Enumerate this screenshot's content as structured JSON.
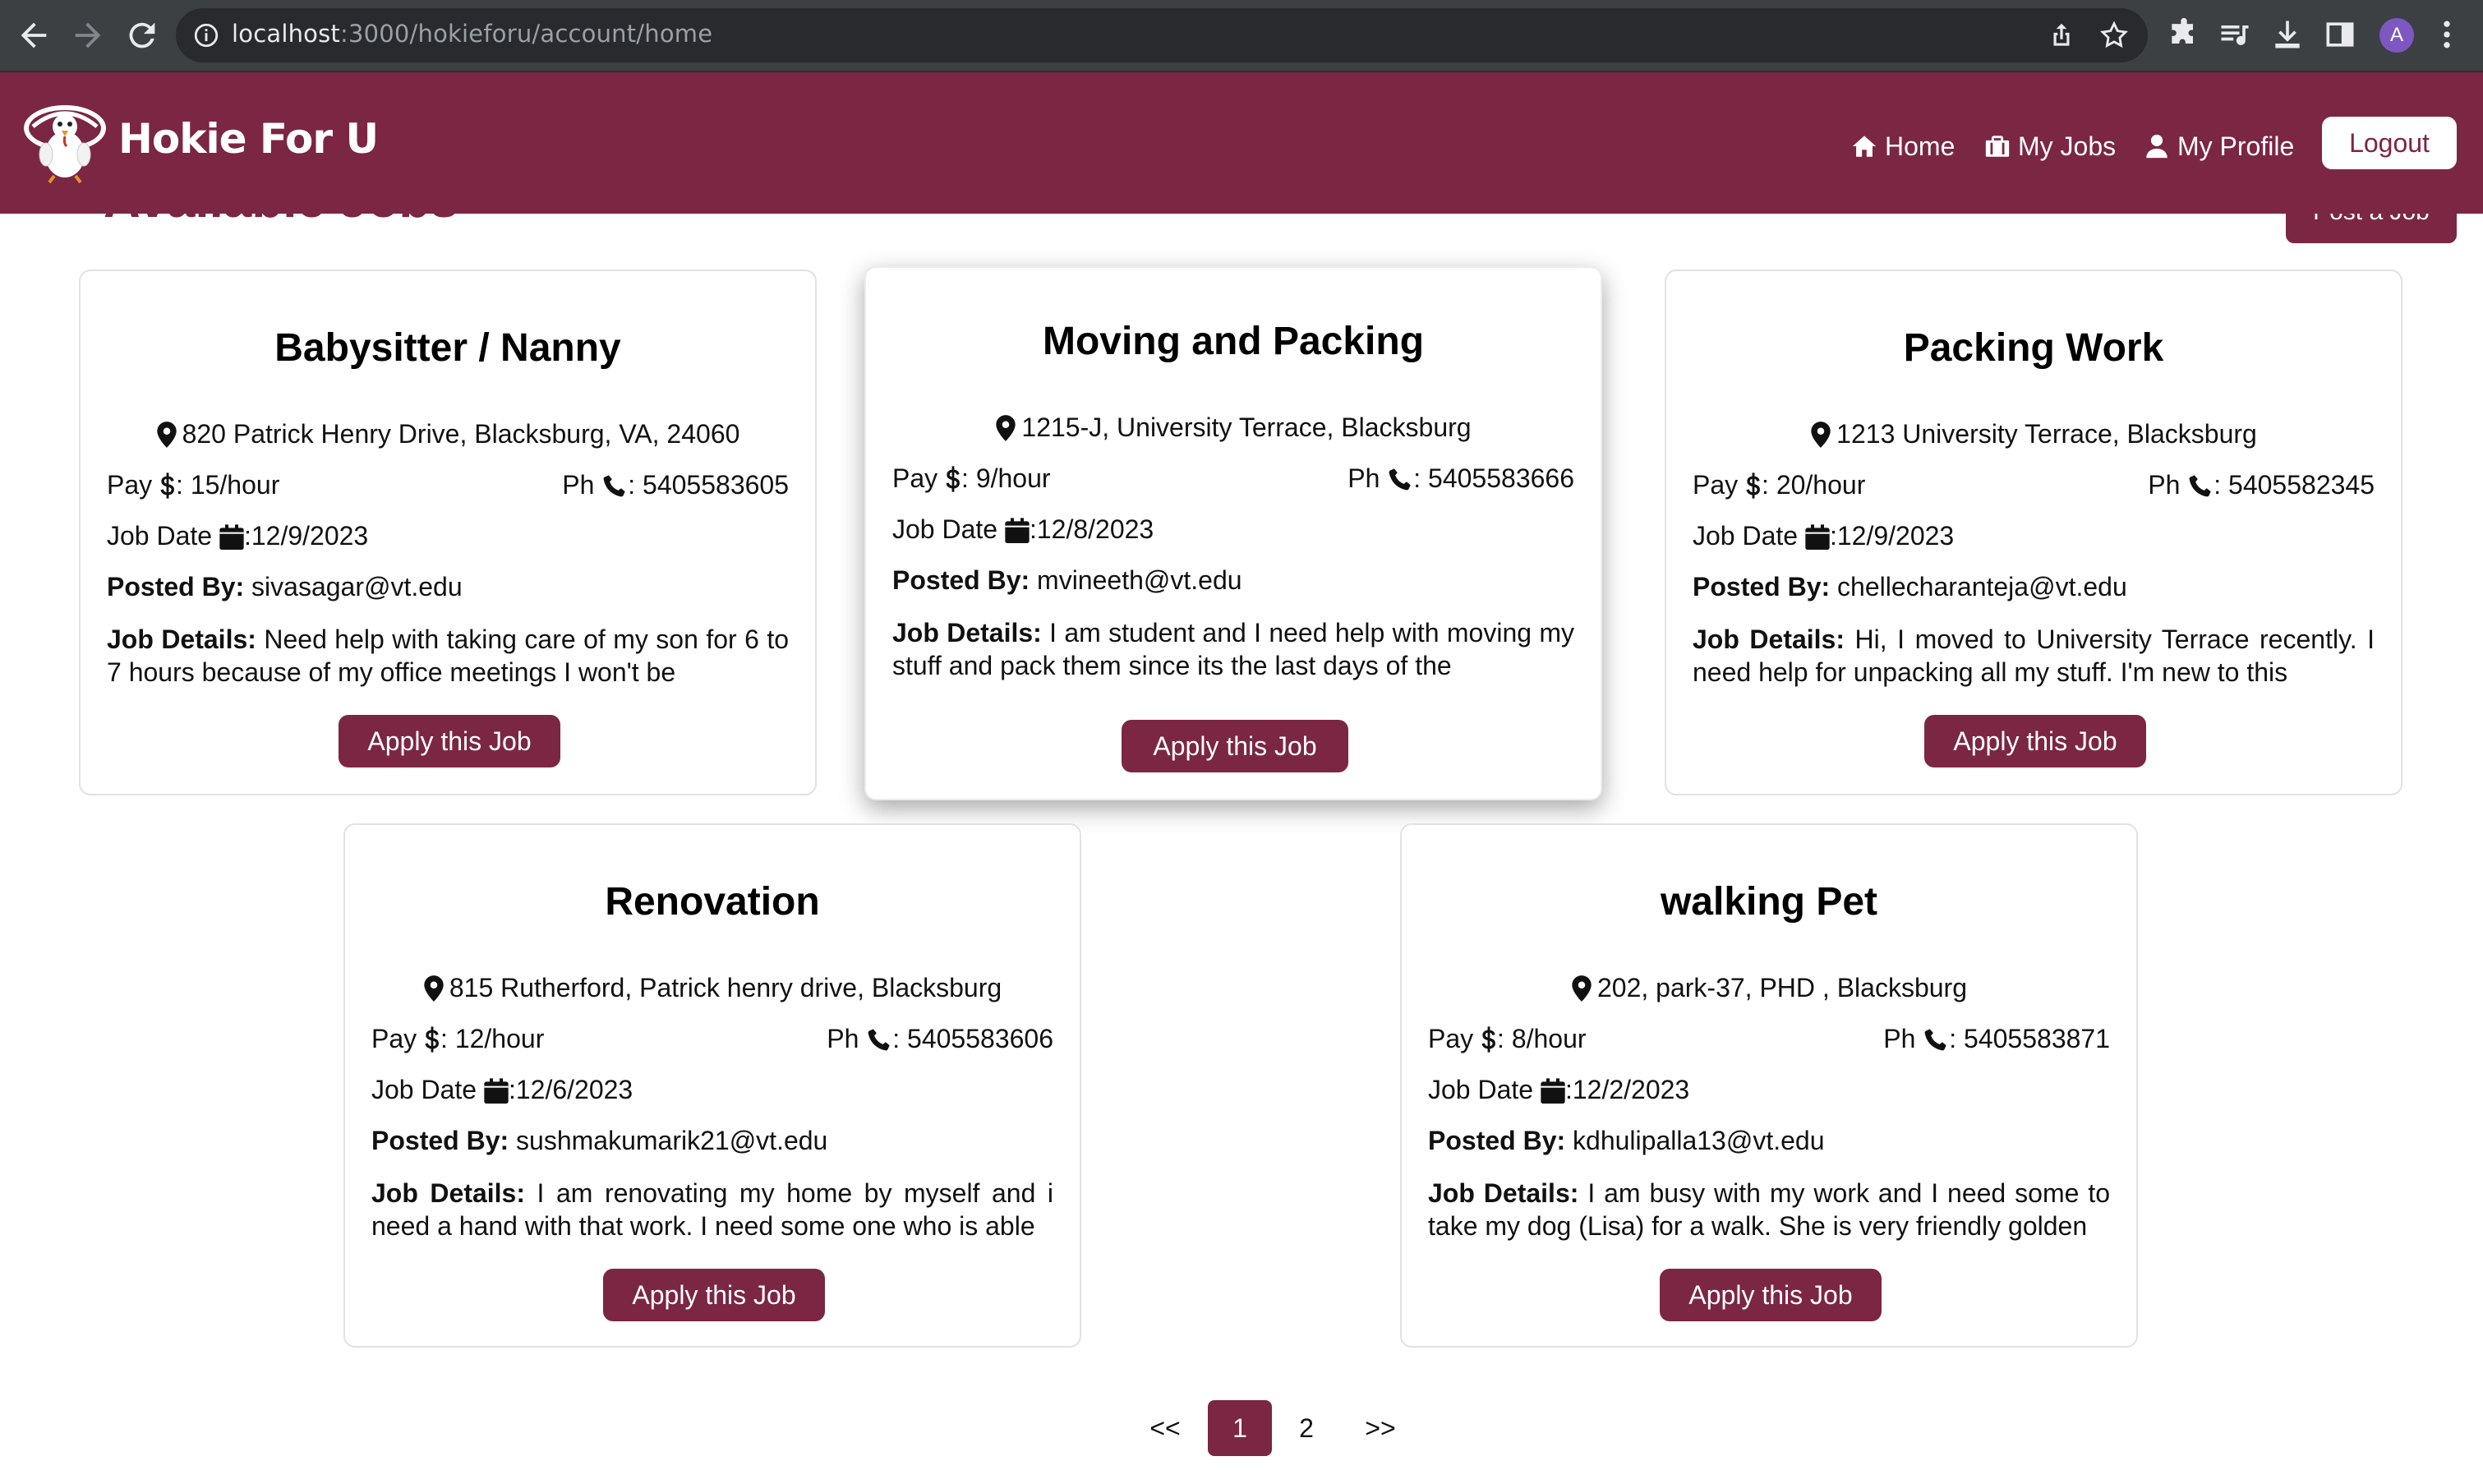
{
  "browser": {
    "url_host": "localhost",
    "url_path": ":3000/hokieforu/account/home",
    "profile_initial": "A"
  },
  "header": {
    "brand": "Hokie For U",
    "nav": {
      "home": "Home",
      "my_jobs": "My Jobs",
      "my_profile": "My Profile"
    },
    "logout": "Logout"
  },
  "main": {
    "section_title": "Available Jobs",
    "post_job": "Post a Job"
  },
  "labels": {
    "pay": "Pay",
    "pay_suffix": ": ",
    "phone": "Ph",
    "phone_suffix": ": ",
    "job_date": "Job Date",
    "posted_by": "Posted By:",
    "job_details": "Job Details:",
    "apply": "Apply this Job"
  },
  "jobs": [
    {
      "title": "Babysitter / Nanny",
      "location": "820 Patrick Henry Drive, Blacksburg, VA, 24060",
      "pay": "15/hour",
      "phone": "5405583605",
      "date": ":12/9/2023",
      "posted_by": "sivasagar@vt.edu",
      "details": "Need help with taking care of my son for 6 to 7 hours because of my office meetings I won't be"
    },
    {
      "title": "Moving and Packing",
      "location": "1215-J, University Terrace, Blacksburg",
      "pay": "9/hour",
      "phone": "5405583666",
      "date": ":12/8/2023",
      "posted_by": "mvineeth@vt.edu",
      "details": "I am student and I need help with moving my stuff and pack them since its the last days of the"
    },
    {
      "title": "Packing Work",
      "location": "1213 University Terrace, Blacksburg",
      "pay": "20/hour",
      "phone": "5405582345",
      "date": ":12/9/2023",
      "posted_by": "chellecharanteja@vt.edu",
      "details": "Hi, I moved to University Terrace recently. I need help for unpacking all my stuff. I'm new to this"
    },
    {
      "title": "Renovation",
      "location": "815 Rutherford, Patrick henry drive, Blacksburg",
      "pay": "12/hour",
      "phone": "5405583606",
      "date": ":12/6/2023",
      "posted_by": "sushmakumarik21@vt.edu",
      "details": "I am renovating my home by myself and i need a hand with that work. I need some one who is able"
    },
    {
      "title": "walking Pet",
      "location": "202, park-37, PHD , Blacksburg",
      "pay": "8/hour",
      "phone": "5405583871",
      "date": ":12/2/2023",
      "posted_by": "kdhulipalla13@vt.edu",
      "details": "I am busy with my work and I need some to take my dog (Lisa) for a walk. She is very friendly golden"
    }
  ],
  "pagination": {
    "prev": "<<",
    "pages": [
      "1",
      "2"
    ],
    "next": ">>",
    "current": "1"
  },
  "colors": {
    "brand": "#7b2642",
    "header_bg": "#7b2642",
    "button_bg": "#7b2642",
    "browser_chrome": "#3c4043"
  },
  "icons": [
    "back-icon",
    "forward-icon",
    "reload-icon",
    "info-icon",
    "share-icon",
    "star-icon",
    "extensions-icon",
    "media-icon",
    "download-icon",
    "sidepanel-icon",
    "menu-icon",
    "home-icon",
    "briefcase-icon",
    "user-icon",
    "map-pin-icon",
    "dollar-icon",
    "phone-icon",
    "calendar-icon"
  ]
}
